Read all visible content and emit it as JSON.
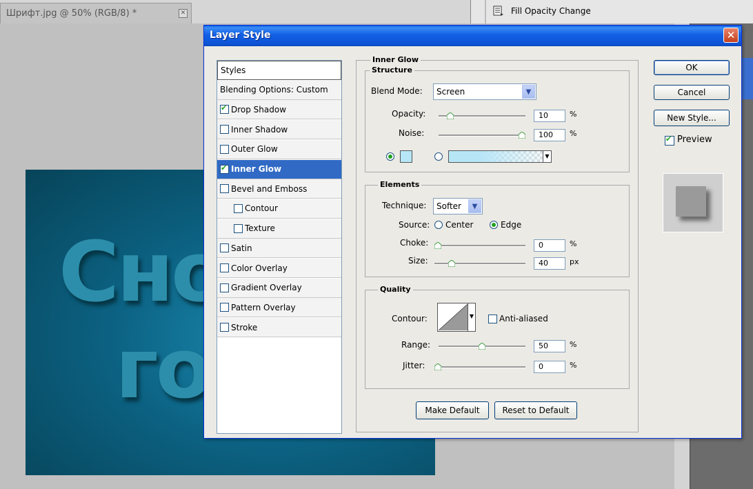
{
  "document_tab": {
    "title": "Шрифт.jpg @ 50% (RGB/8) *",
    "close": "✕"
  },
  "history": {
    "item_label": "Fill Opacity Change"
  },
  "artwork": {
    "line1": "Сно",
    "line2": "го"
  },
  "dialog": {
    "title": "Layer Style",
    "close": "✕",
    "styles_list": [
      {
        "label": "Styles",
        "type": "header"
      },
      {
        "label": "Blending Options: Custom",
        "type": "plain"
      },
      {
        "label": "Drop Shadow",
        "checked": true
      },
      {
        "label": "Inner Shadow",
        "checked": false
      },
      {
        "label": "Outer Glow",
        "checked": false
      },
      {
        "label": "Inner Glow",
        "checked": true,
        "selected": true
      },
      {
        "label": "Bevel and Emboss",
        "checked": false
      },
      {
        "label": "Contour",
        "checked": false,
        "indent": true
      },
      {
        "label": "Texture",
        "checked": false,
        "indent": true
      },
      {
        "label": "Satin",
        "checked": false
      },
      {
        "label": "Color Overlay",
        "checked": false
      },
      {
        "label": "Gradient Overlay",
        "checked": false
      },
      {
        "label": "Pattern Overlay",
        "checked": false
      },
      {
        "label": "Stroke",
        "checked": false
      }
    ],
    "inner_glow": {
      "title": "Inner Glow",
      "structure": {
        "title": "Structure",
        "blend_mode_label": "Blend Mode:",
        "blend_mode_value": "Screen",
        "opacity_label": "Opacity:",
        "opacity_value": "10",
        "opacity_level": 10,
        "noise_label": "Noise:",
        "noise_value": "100",
        "noise_level": 100,
        "percent": "%",
        "glow_color": "#b7e6f7"
      },
      "elements": {
        "title": "Elements",
        "technique_label": "Technique:",
        "technique_value": "Softer",
        "source_label": "Source:",
        "source_center": "Center",
        "source_edge": "Edge",
        "choke_label": "Choke:",
        "choke_value": "0",
        "choke_level": 0,
        "size_label": "Size:",
        "size_value": "40",
        "size_level": 16,
        "size_unit": "px",
        "percent": "%"
      },
      "quality": {
        "title": "Quality",
        "contour_label": "Contour:",
        "anti_aliased_label": "Anti-aliased",
        "range_label": "Range:",
        "range_value": "50",
        "range_level": 50,
        "jitter_label": "Jitter:",
        "jitter_value": "0",
        "jitter_level": 0,
        "percent": "%"
      },
      "make_default": "Make Default",
      "reset_default": "Reset to Default"
    },
    "buttons": {
      "ok": "OK",
      "cancel": "Cancel",
      "new_style": "New Style...",
      "preview": "Preview"
    }
  }
}
